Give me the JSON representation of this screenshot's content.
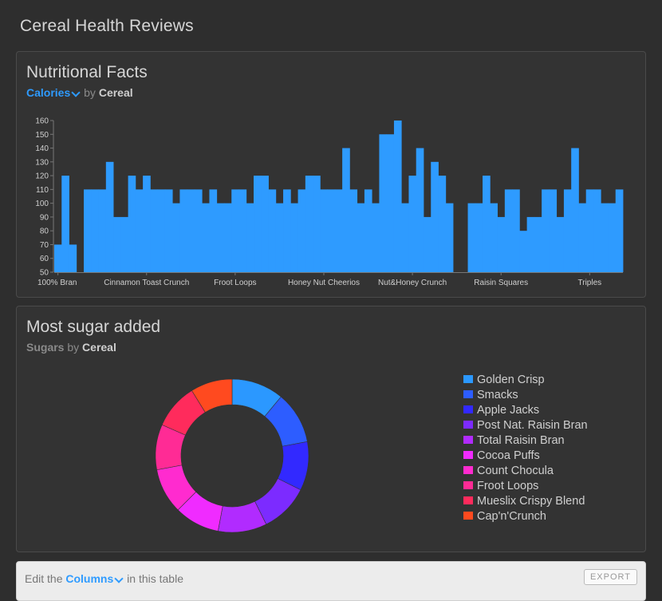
{
  "app": {
    "title": "Cereal Health Reviews"
  },
  "nutrition_panel": {
    "title": "Nutritional Facts",
    "metric": "Calories",
    "by_text": "by",
    "dimension": "Cereal"
  },
  "sugar_panel": {
    "title": "Most sugar added",
    "metric": "Sugars",
    "by_text": "by",
    "dimension": "Cereal"
  },
  "footer": {
    "prefix": "Edit the",
    "columns_label": "Columns",
    "suffix": "in this table",
    "export_label": "EXPORT"
  },
  "chart_data": [
    {
      "type": "bar",
      "ylim": [
        50,
        160
      ],
      "y_ticks": [
        50,
        60,
        70,
        80,
        90,
        100,
        110,
        120,
        130,
        140,
        150,
        160
      ],
      "values": [
        70,
        120,
        70,
        50,
        110,
        110,
        110,
        130,
        90,
        90,
        120,
        110,
        120,
        110,
        110,
        110,
        100,
        110,
        110,
        110,
        100,
        110,
        100,
        100,
        110,
        110,
        100,
        120,
        120,
        110,
        100,
        110,
        100,
        110,
        120,
        120,
        110,
        110,
        110,
        140,
        110,
        100,
        110,
        100,
        150,
        150,
        160,
        100,
        120,
        140,
        90,
        130,
        120,
        100,
        50,
        50,
        100,
        100,
        120,
        100,
        90,
        110,
        110,
        80,
        90,
        90,
        110,
        110,
        90,
        110,
        140,
        100,
        110,
        110,
        100,
        100,
        110
      ],
      "x_tick_labels": [
        {
          "index": 0,
          "label": "100% Bran"
        },
        {
          "index": 12,
          "label": "Cinnamon Toast Crunch"
        },
        {
          "index": 24,
          "label": "Froot Loops"
        },
        {
          "index": 36,
          "label": "Honey Nut Cheerios"
        },
        {
          "index": 48,
          "label": "Nut&Honey Crunch"
        },
        {
          "index": 60,
          "label": "Raisin Squares"
        },
        {
          "index": 72,
          "label": "Triples"
        }
      ],
      "color": "#2e9bff"
    },
    {
      "type": "pie",
      "categories": [
        "Golden Crisp",
        "Smacks",
        "Apple Jacks",
        "Post Nat. Raisin Bran",
        "Total Raisin Bran",
        "Cocoa Puffs",
        "Count Chocula",
        "Froot Loops",
        "Mueslix Crispy Blend",
        "Cap'n'Crunch"
      ],
      "values": [
        15,
        15,
        14,
        14,
        14,
        13,
        13,
        13,
        13,
        12
      ],
      "colors": [
        "#2b98ff",
        "#2d5dff",
        "#3229ff",
        "#7c2bff",
        "#b12bff",
        "#f02bff",
        "#ff2bcf",
        "#ff2b95",
        "#ff2b5c",
        "#ff4a1f"
      ]
    }
  ]
}
